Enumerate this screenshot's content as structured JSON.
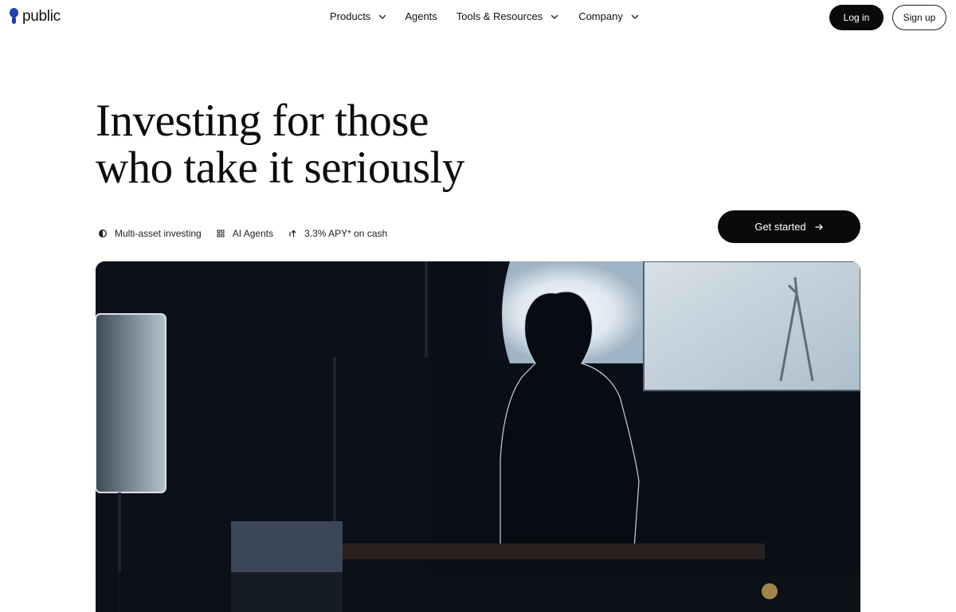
{
  "header": {
    "logo_text": "public",
    "nav": [
      {
        "label": "Products",
        "has_dropdown": true
      },
      {
        "label": "Agents",
        "has_dropdown": false
      },
      {
        "label": "Tools & Resources",
        "has_dropdown": true
      },
      {
        "label": "Company",
        "has_dropdown": true
      }
    ],
    "login_label": "Log in",
    "signup_label": "Sign up"
  },
  "hero": {
    "headline_line1": "Investing for those",
    "headline_line2": "who take it seriously",
    "features": [
      {
        "icon": "half-circle-icon",
        "label": "Multi-asset investing"
      },
      {
        "icon": "grid-dots-icon",
        "label": "AI Agents"
      },
      {
        "icon": "arrow-up-right-icon",
        "label": "3.3% APY* on cash"
      }
    ],
    "cta_label": "Get started"
  },
  "colors": {
    "brand": "#1b3fb8",
    "button_dark": "#0a0a0a",
    "text": "#111111"
  }
}
